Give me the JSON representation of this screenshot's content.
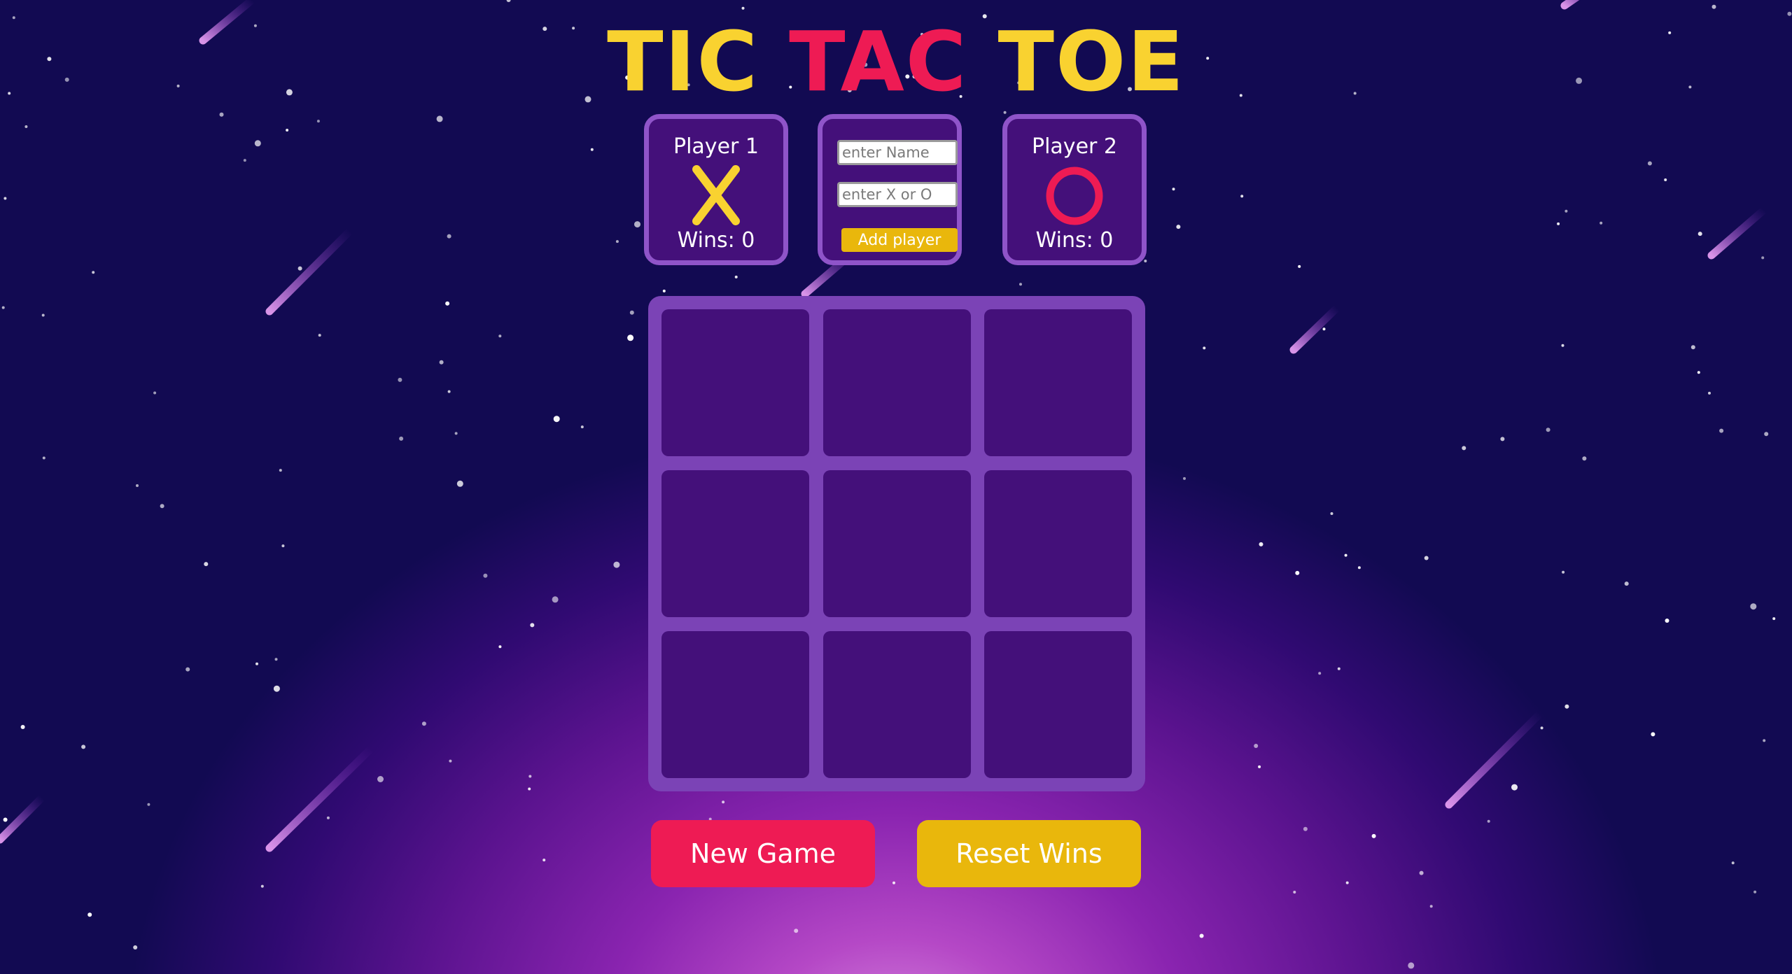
{
  "title": {
    "word1": "TIC",
    "word2": "TAC",
    "word3": "TOE",
    "color_primary": "#f9d230",
    "color_accent": "#ee1b54"
  },
  "player1": {
    "name": "Player 1",
    "symbol": "X",
    "wins_label": "Wins: 0",
    "wins": 0,
    "symbol_color": "#f9d230"
  },
  "player2": {
    "name": "Player 2",
    "symbol": "O",
    "wins_label": "Wins: 0",
    "wins": 0,
    "symbol_color": "#ee1b54"
  },
  "add_player": {
    "name_placeholder": "enter Name",
    "symbol_placeholder": "enter X or O",
    "button_label": "Add player"
  },
  "board": {
    "cells": [
      "",
      "",
      "",
      "",
      "",
      "",
      "",
      "",
      ""
    ]
  },
  "controls": {
    "new_game_label": "New Game",
    "reset_wins_label": "Reset Wins",
    "new_game_color": "#ee1b54",
    "reset_wins_color": "#e9b70c"
  }
}
